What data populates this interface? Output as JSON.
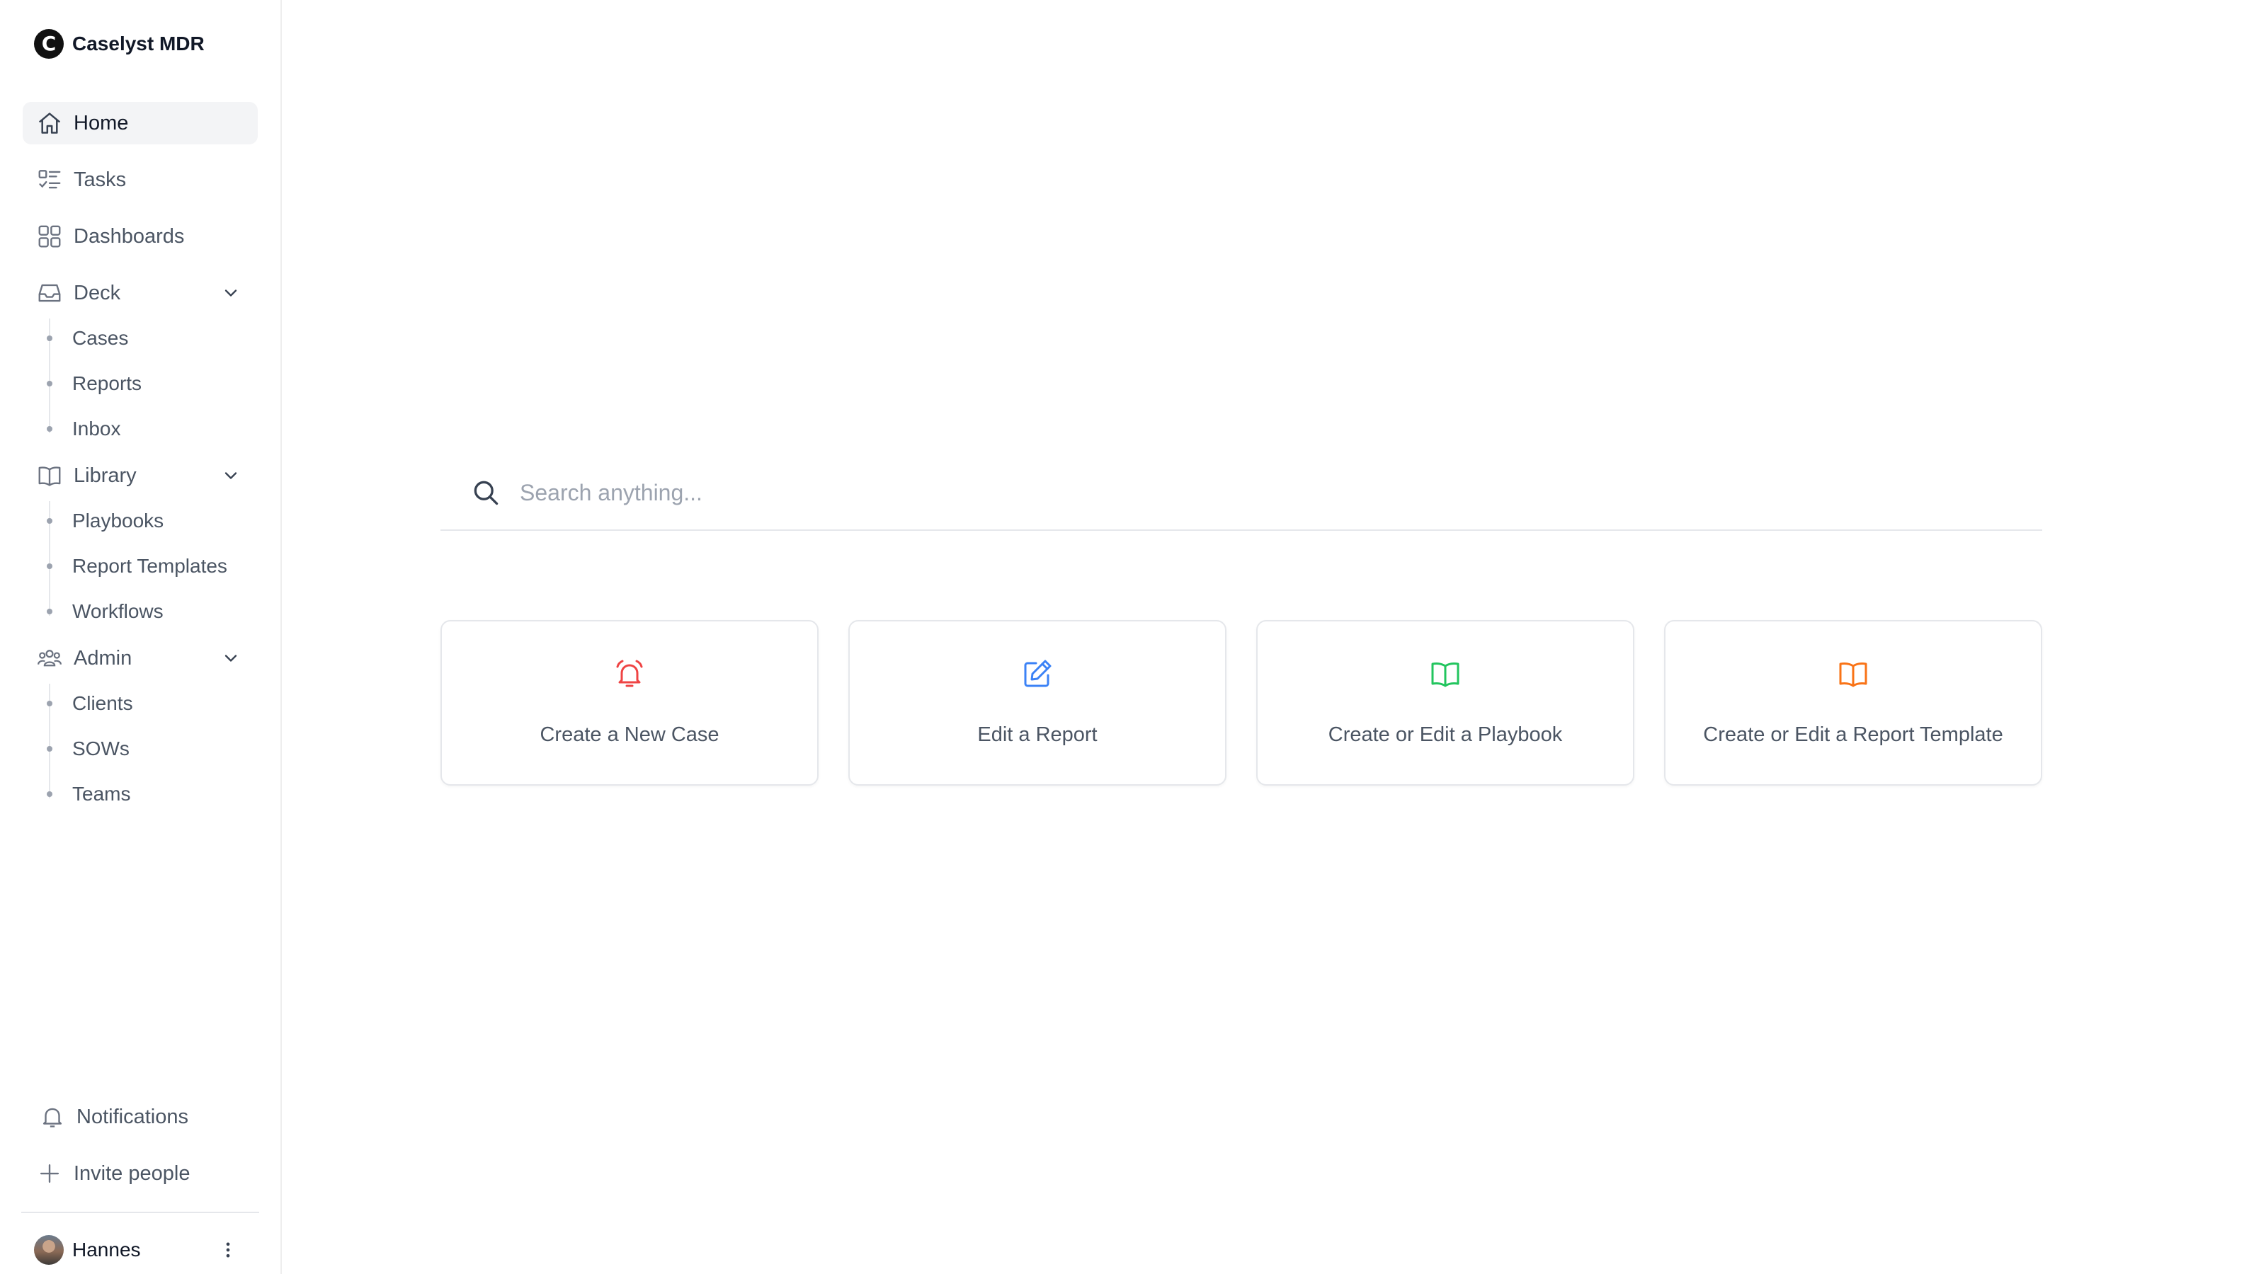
{
  "app": {
    "name": "Caselyst MDR",
    "logo_letter": "C"
  },
  "sidebar": {
    "main_items": [
      {
        "label": "Home",
        "icon": "home-icon",
        "active": true
      },
      {
        "label": "Tasks",
        "icon": "tasks-icon"
      },
      {
        "label": "Dashboards",
        "icon": "dashboard-grid-icon"
      }
    ],
    "groups": {
      "deck": {
        "label": "Deck",
        "icon": "inbox-tray-icon",
        "expanded": true,
        "items": [
          "Cases",
          "Reports",
          "Inbox"
        ]
      },
      "library": {
        "label": "Library",
        "icon": "open-book-icon",
        "expanded": true,
        "items": [
          "Playbooks",
          "Report Templates",
          "Workflows"
        ]
      },
      "admin": {
        "label": "Admin",
        "icon": "users-group-icon",
        "expanded": true,
        "items": [
          "Clients",
          "SOWs",
          "Teams"
        ]
      }
    },
    "bottom": {
      "notifications": {
        "label": "Notifications",
        "icon": "bell-icon"
      },
      "invite": {
        "label": "Invite people",
        "icon": "plus-icon"
      },
      "user": {
        "name": "Hannes"
      }
    }
  },
  "search": {
    "placeholder": "Search anything..."
  },
  "quick_actions": [
    {
      "label": "Create a New Case",
      "icon": "alarm-bell-icon",
      "color": "#ef4444"
    },
    {
      "label": "Edit a Report",
      "icon": "edit-pencil-icon",
      "color": "#3b82f6"
    },
    {
      "label": "Create or Edit a Playbook",
      "icon": "open-book-icon",
      "color": "#22c55e"
    },
    {
      "label": "Create or Edit a Report Template",
      "icon": "open-book-icon",
      "color": "#f97316"
    }
  ]
}
